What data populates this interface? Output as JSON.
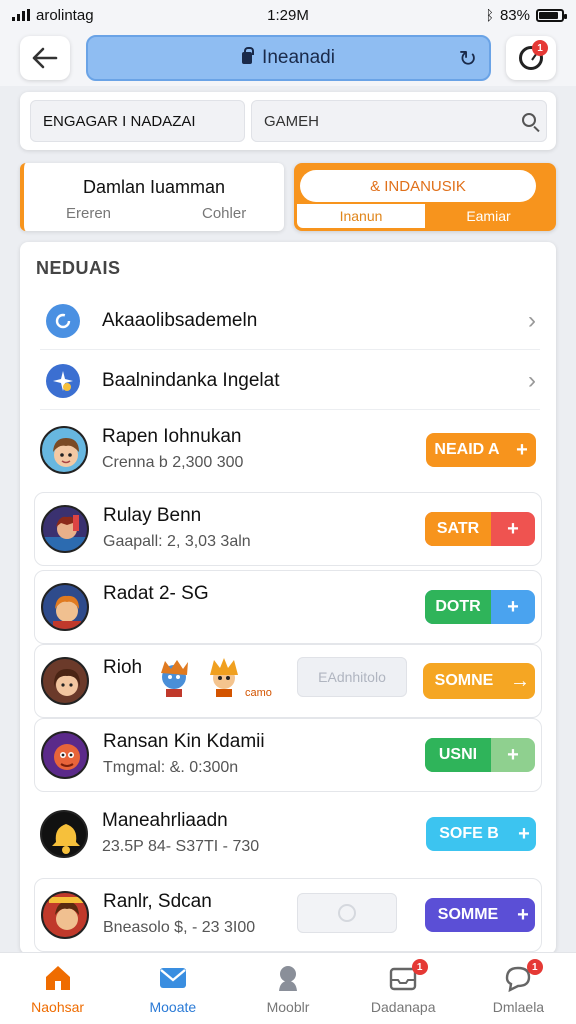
{
  "status_bar": {
    "carrier": "arolintag",
    "time": "1:29M",
    "battery": "83%"
  },
  "topnav": {
    "url_text": "Ineanadi",
    "timer_badge": "1"
  },
  "search": {
    "filter_value": "ENGAGAR I NADAZAI",
    "search_value": "GAMEH"
  },
  "toggle_left": {
    "title": "Damlan Iuamman",
    "sub1": "Ereren",
    "sub2": "Cohler"
  },
  "toggle_right": {
    "pill": "& INDANUSIK",
    "seg_left": "Inanun",
    "seg_right": "Eamiar"
  },
  "list": {
    "section_title": "NEDUAIS",
    "nav_items": [
      {
        "label": "Akaaolibsademeln",
        "icon": "refresh-circle-icon"
      },
      {
        "label": "Baalnindanka Ingelat",
        "icon": "sparkle-icon"
      }
    ],
    "games": [
      {
        "title": "Rapen Iohnukan",
        "sub": "Crenna b 2,300 300",
        "button": "NEAID A",
        "button_end": "+"
      },
      {
        "title": "Rulay Benn",
        "sub": "Gaapall: 2, 3,03 3aln",
        "button": "SATR",
        "button_end": "+"
      },
      {
        "title": "Radat 2- SG",
        "sub": "",
        "button": "DOTR",
        "button_end": "+"
      },
      {
        "title": "Rioh",
        "sub": "",
        "button": "SOMNE",
        "button_end": "→",
        "ghost": "EAdnhitolo",
        "char_caption": "camo"
      },
      {
        "title": "Ransan Kin Kdamii",
        "sub": "Tmgmal: &. 0:300n",
        "button": "USNI",
        "button_end": "+"
      },
      {
        "title": "Maneahrliaadn",
        "sub": "23.5P 84- S37TI - 730",
        "button": "SOFE B",
        "button_end": "+"
      },
      {
        "title": "Ranlr, Sdcan",
        "sub": "Bneasolo $, - 23 3I00",
        "button": "SOMME",
        "button_end": "+"
      }
    ]
  },
  "bottom_nav": [
    {
      "label": "Naohsar",
      "icon": "home-icon",
      "badge": ""
    },
    {
      "label": "Mooate",
      "icon": "mail-icon",
      "badge": ""
    },
    {
      "label": "Mooblr",
      "icon": "profile-icon",
      "badge": ""
    },
    {
      "label": "Dadanapa",
      "icon": "inbox-icon",
      "badge": "1"
    },
    {
      "label": "Dmlaela",
      "icon": "chat-icon",
      "badge": "1"
    }
  ],
  "colors": {
    "accent_orange": "#f7941d",
    "url_blue": "#8fbdf2",
    "btn_orange": "#f7941d",
    "btn_red": "#ef5350",
    "btn_green": "#2fb45a",
    "btn_blue": "#4aa3ef",
    "btn_cyan": "#3cc4f0",
    "btn_purple": "#5b4fd6"
  }
}
